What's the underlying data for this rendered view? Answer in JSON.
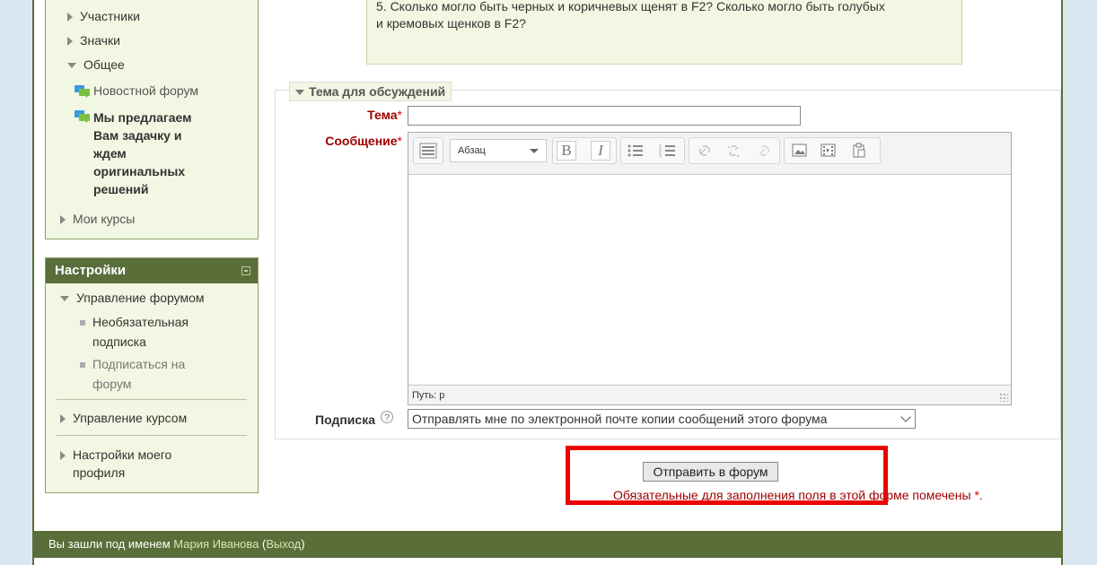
{
  "nav": {
    "items": [
      {
        "label": "Участники",
        "type": "collapsed"
      },
      {
        "label": "Значки",
        "type": "collapsed"
      },
      {
        "label": "Общее",
        "type": "expanded"
      },
      {
        "label": "Новостной форум",
        "type": "link"
      },
      {
        "label": "Мы предлагаем Вам задачку и ждем оригинальных решений",
        "type": "current"
      },
      {
        "label": "Мои курсы",
        "type": "collapsed"
      }
    ],
    "current_lines": [
      "Мы предлагаем",
      "Вам задачку и",
      "ждем",
      "оригинальных",
      "решений"
    ]
  },
  "settings": {
    "title": "Настройки",
    "forum_admin": "Управление форумом",
    "optional_sub": [
      "Необязательная",
      "подписка"
    ],
    "subscribe": [
      "Подписаться на",
      "форум"
    ],
    "course_admin": "Управление курсом",
    "profile": [
      "Настройки моего",
      "профиля"
    ]
  },
  "question": {
    "line1": "5. Сколько могло быть черных и коричневых щенят в F2? Сколько могло быть голубых",
    "line2": "и кремовых щенков в F2?"
  },
  "form": {
    "legend": "Тема для обсуждений",
    "subject_label": "Тема",
    "message_label": "Сообщение",
    "required_mark": "*",
    "subject_value": "",
    "format_select": "Абзац",
    "path_label": "Путь: p",
    "subscription_label": "Подписка",
    "subscription_value": "Отправлять мне по электронной почте копии сообщений этого форума",
    "submit": "Отправить в форум",
    "required_note": "Обязательные для заполнения поля в этой форме помечены",
    "required_star": "*."
  },
  "footer": {
    "logged_in_as": "Вы зашли под именем",
    "user": "Мария Иванова",
    "logout": "Выход"
  },
  "colors": {
    "accent": "#5a6e3a",
    "block_bg": "#f1f7e2",
    "required": "#a00000",
    "highlight": "#e00000"
  }
}
